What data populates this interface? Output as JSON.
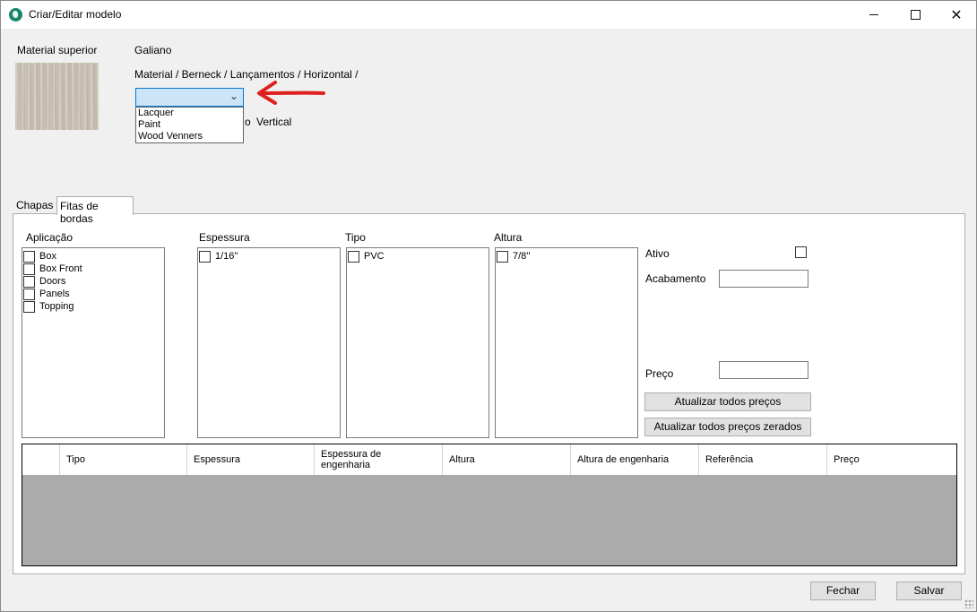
{
  "window": {
    "title": "Criar/Editar modelo"
  },
  "header": {
    "material_label": "Material superior",
    "material_name": "Galiano",
    "material_path": "Material / Berneck / Lançamentos / Horizontal /",
    "orientation_hidden_label": "o",
    "orientation_label": "Vertical",
    "dropdown_options": [
      "Lacquer",
      "Paint",
      "Wood Venners"
    ]
  },
  "tabs": [
    "Chapas",
    "Fitas de bordas"
  ],
  "filters": {
    "aplicacao": {
      "label": "Aplicação",
      "items": [
        "Box",
        "Box Front",
        "Doors",
        "Panels",
        "Topping"
      ]
    },
    "espessura": {
      "label": "Espessura",
      "items": [
        "1/16''"
      ]
    },
    "tipo": {
      "label": "Tipo",
      "items": [
        "PVC"
      ]
    },
    "altura": {
      "label": "Altura",
      "items": [
        "7/8''"
      ]
    }
  },
  "form": {
    "ativo_label": "Ativo",
    "acabamento_label": "Acabamento",
    "preco_label": "Preço",
    "update_all_button": "Atualizar todos preços",
    "update_zero_button": "Atualizar todos preços zerados"
  },
  "grid": {
    "columns": [
      "Tipo",
      "Espessura",
      "Espessura de engenharia",
      "Altura",
      "Altura de engenharia",
      "Referência",
      "Preço"
    ]
  },
  "footer": {
    "close_button": "Fechar",
    "save_button": "Salvar"
  },
  "colors": {
    "accent": "#0078d7",
    "combo_bg": "#cce4f7",
    "arrow": "#e0201c",
    "grid_bg": "#ababab"
  }
}
